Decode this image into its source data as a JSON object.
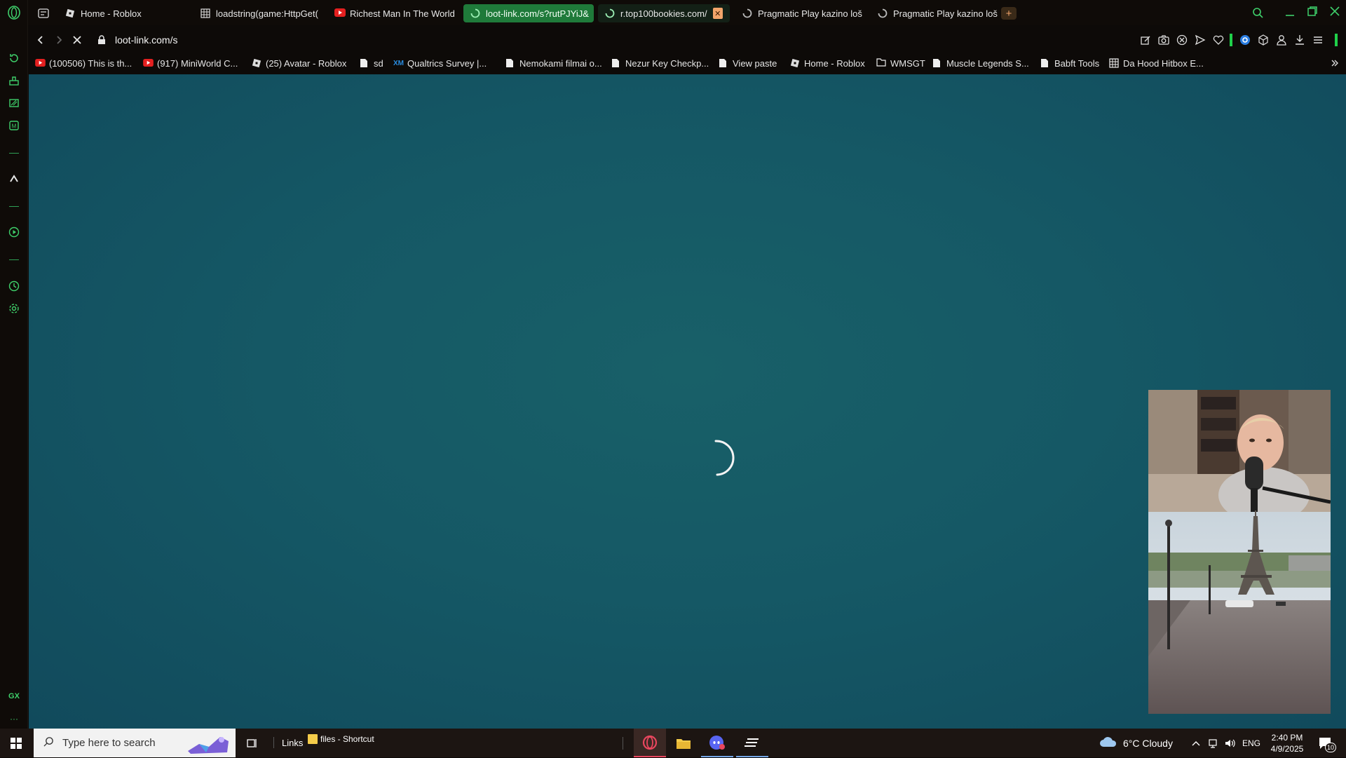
{
  "tabs": [
    {
      "label": "Home - Roblox",
      "fav": "roblox-icon"
    },
    {
      "label": "loadstring(game:HttpGet(",
      "fav": "page-icon"
    },
    {
      "label": "Richest Man In The World",
      "fav": "youtube-icon"
    },
    {
      "label": "loot-link.com/s?rutPJYiJ&",
      "fav": "loading-spinner-icon"
    },
    {
      "label": "r.top100bookies.com/",
      "fav": "loading-spinner-icon"
    },
    {
      "label": "Pragmatic Play kazino loš",
      "fav": "loading-spinner-icon"
    },
    {
      "label": "Pragmatic Play kazino loš",
      "fav": "loading-spinner-icon"
    }
  ],
  "address": {
    "url": "loot-link.com/s"
  },
  "bookmarks": [
    {
      "label": "(100506) This is th...",
      "icon": "youtube-icon"
    },
    {
      "label": "(917) MiniWorld C...",
      "icon": "youtube-icon"
    },
    {
      "label": "(25) Avatar - Roblox",
      "icon": "roblox-icon"
    },
    {
      "label": "sd",
      "icon": "page-icon"
    },
    {
      "label": "Qualtrics Survey |...",
      "icon": "xm-icon"
    },
    {
      "label": "Nemokami filmai o...",
      "icon": "page-icon"
    },
    {
      "label": "Nezur Key Checkp...",
      "icon": "page-icon"
    },
    {
      "label": "View paste",
      "icon": "page-icon"
    },
    {
      "label": "Home - Roblox",
      "icon": "roblox-icon"
    },
    {
      "label": "WMSGT",
      "icon": "folder-icon"
    },
    {
      "label": "Muscle Legends S...",
      "icon": "page-icon"
    },
    {
      "label": "Babft Tools",
      "icon": "page-icon"
    },
    {
      "label": "Da Hood Hitbox E...",
      "icon": "grid-icon"
    }
  ],
  "sidebar": {
    "gx_label": "GX",
    "more_label": "···"
  },
  "taskbar": {
    "search_placeholder": "Type here to search",
    "links_label": "Links",
    "shortcut_label": "files - Shortcut",
    "weather": "6°C  Cloudy",
    "lang": "ENG",
    "time": "2:40 PM",
    "date": "4/9/2025",
    "notification_count": "10"
  },
  "colors": {
    "accent": "#1f7a3a",
    "page_bg": "#155865",
    "sidebar_icon": "#3fd06b"
  }
}
